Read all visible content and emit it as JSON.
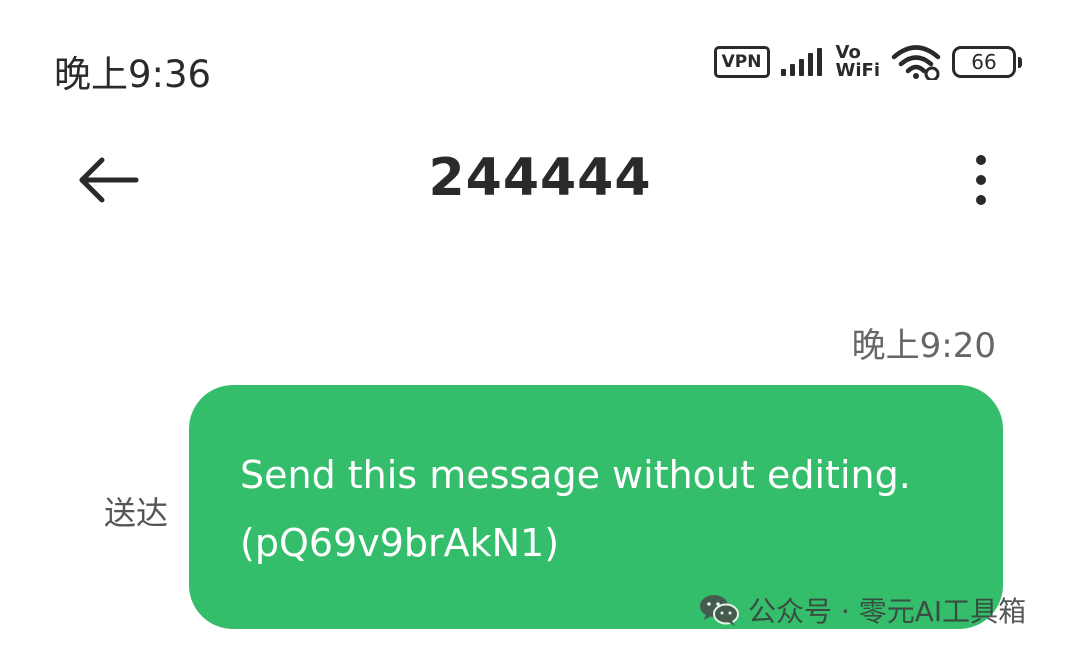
{
  "status_bar": {
    "time": "晚上9:36",
    "vpn_label": "VPN",
    "vowifi_top": "Vo",
    "vowifi_bottom": "WiFi",
    "battery_level": "66",
    "icons": [
      "signal-bars-icon",
      "wifi-icon",
      "battery-icon"
    ]
  },
  "header": {
    "back_icon": "arrow-left-icon",
    "title": "244444",
    "more_icon": "more-vertical-icon"
  },
  "conversation": {
    "message_time": "晚上9:20",
    "messages": [
      {
        "status": "送达",
        "line1": "Send this message without editing.",
        "line2": "(pQ69v9brAkN1)",
        "bubble_color": "#34bd6b"
      }
    ]
  },
  "watermark": {
    "icon": "wechat-logo-icon",
    "text": "公众号 · 零元AI工具箱"
  }
}
